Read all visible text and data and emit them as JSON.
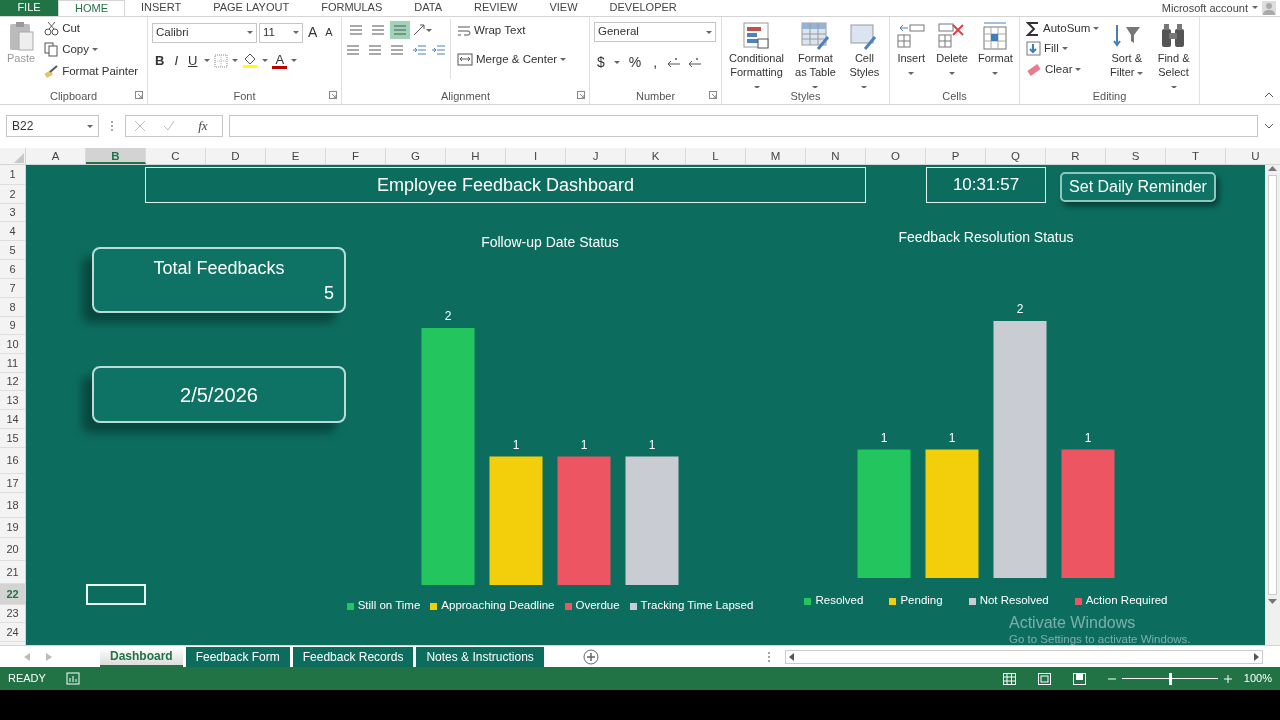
{
  "ribbon_tabs": [
    {
      "label": "FILE",
      "kind": "file",
      "selected": false
    },
    {
      "label": "HOME",
      "kind": "tab",
      "selected": true
    },
    {
      "label": "INSERT",
      "kind": "tab",
      "selected": false
    },
    {
      "label": "PAGE LAYOUT",
      "kind": "tab",
      "selected": false
    },
    {
      "label": "FORMULAS",
      "kind": "tab",
      "selected": false
    },
    {
      "label": "DATA",
      "kind": "tab",
      "selected": false
    },
    {
      "label": "REVIEW",
      "kind": "tab",
      "selected": false
    },
    {
      "label": "VIEW",
      "kind": "tab",
      "selected": false
    },
    {
      "label": "DEVELOPER",
      "kind": "tab",
      "selected": false
    }
  ],
  "account": "Microsoft account",
  "ribbon_groups": [
    {
      "kind": "clipboard",
      "label": "Clipboard",
      "buttons": [
        {
          "label": "Paste",
          "disabled": true
        },
        {
          "label": "Cut",
          "disabled": false
        },
        {
          "label": "Copy",
          "disabled": false
        },
        {
          "label": "Format Painter",
          "disabled": false
        }
      ]
    },
    {
      "kind": "font",
      "label": "Font",
      "font_name": "Calibri",
      "font_size": "11",
      "buttons": [
        "A",
        "A",
        "B",
        "I",
        "U",
        "A"
      ]
    },
    {
      "kind": "alignment",
      "label": "Alignment",
      "vertical_align": [
        {
          "selected": false
        },
        {
          "selected": false
        },
        {
          "selected": true
        }
      ],
      "buttons": [
        "Wrap Text",
        "Merge & Center"
      ]
    },
    {
      "kind": "number",
      "label": "Number",
      "format": "General",
      "buttons": [
        "$",
        "%",
        ","
      ]
    },
    {
      "kind": "large",
      "label": "Styles",
      "buttons": [
        "Conditional Formatting",
        "Format as Table",
        "Cell Styles"
      ]
    },
    {
      "kind": "large",
      "label": "Cells",
      "buttons": [
        "Insert",
        "Delete",
        "Format"
      ]
    },
    {
      "kind": "editing",
      "label": "Editing",
      "buttons": [
        "AutoSum",
        "Fill",
        "Clear",
        "Sort & Filter",
        "Find & Select"
      ]
    }
  ],
  "formula_bar": {
    "name_box": "B22",
    "function_label": "fx"
  },
  "columns": [
    {
      "label": "A",
      "selected": false
    },
    {
      "label": "B",
      "selected": true
    },
    {
      "label": "C",
      "selected": false
    },
    {
      "label": "D",
      "selected": false
    },
    {
      "label": "E",
      "selected": false
    },
    {
      "label": "F",
      "selected": false
    },
    {
      "label": "G",
      "selected": false
    },
    {
      "label": "H",
      "selected": false
    },
    {
      "label": "I",
      "selected": false
    },
    {
      "label": "J",
      "selected": false
    },
    {
      "label": "K",
      "selected": false
    },
    {
      "label": "L",
      "selected": false
    },
    {
      "label": "M",
      "selected": false
    },
    {
      "label": "N",
      "selected": false
    },
    {
      "label": "O",
      "selected": false
    },
    {
      "label": "P",
      "selected": false
    },
    {
      "label": "Q",
      "selected": false
    },
    {
      "label": "R",
      "selected": false
    },
    {
      "label": "S",
      "selected": false
    },
    {
      "label": "T",
      "selected": false
    },
    {
      "label": "U",
      "selected": false
    }
  ],
  "rows": [
    {
      "label": "1",
      "selected": false
    },
    {
      "label": "2",
      "selected": false
    },
    {
      "label": "3",
      "selected": false
    },
    {
      "label": "4",
      "selected": false
    },
    {
      "label": "5",
      "selected": false
    },
    {
      "label": "6",
      "selected": false
    },
    {
      "label": "7",
      "selected": false
    },
    {
      "label": "8",
      "selected": false
    },
    {
      "label": "9",
      "selected": false
    },
    {
      "label": "10",
      "selected": false
    },
    {
      "label": "11",
      "selected": false
    },
    {
      "label": "12",
      "selected": false
    },
    {
      "label": "13",
      "selected": false
    },
    {
      "label": "14",
      "selected": false
    },
    {
      "label": "15",
      "selected": false
    },
    {
      "label": "16",
      "selected": false
    },
    {
      "label": "17",
      "selected": false
    },
    {
      "label": "18",
      "selected": false
    },
    {
      "label": "19",
      "selected": false
    },
    {
      "label": "20",
      "selected": false
    },
    {
      "label": "21",
      "selected": false
    },
    {
      "label": "22",
      "selected": true
    },
    {
      "label": "23",
      "selected": false
    },
    {
      "label": "24",
      "selected": false
    }
  ],
  "dashboard": {
    "title": "Employee Feedback Dashboard",
    "clock": "10:31:57",
    "reminder_button": "Set Daily Reminder",
    "total_card": {
      "label": "Total Feedbacks",
      "value": "5"
    },
    "date_card": "2/5/2026",
    "charts": [
      {
        "chart_data": {
          "type": "bar",
          "title": "Follow-up Date Status",
          "series": [
            {
              "name": "Still on Time",
              "color": "#22c55e",
              "values": [
                2
              ]
            },
            {
              "name": "Approaching Deadline",
              "color": "#f2cf0a",
              "values": [
                1
              ]
            },
            {
              "name": "Overdue",
              "color": "#ee5563",
              "values": [
                1
              ]
            },
            {
              "name": "Tracking Time Lapsed",
              "color": "#c9cdd3",
              "values": [
                1
              ]
            }
          ],
          "data_labels": true
        }
      },
      {
        "chart_data": {
          "type": "bar",
          "title": "Feedback Resolution Status",
          "series": [
            {
              "name": "Resolved",
              "color": "#22c55e",
              "values": [
                1
              ]
            },
            {
              "name": "Pending",
              "color": "#f2cf0a",
              "values": [
                1
              ]
            },
            {
              "name": "Not Resolved",
              "color": "#c9cdd3",
              "values": [
                2
              ]
            },
            {
              "name": "Action Required",
              "color": "#ee5563",
              "values": [
                1
              ]
            }
          ],
          "data_labels": true
        }
      }
    ]
  },
  "os_notice": {
    "title": "Activate Windows",
    "text": "Go to Settings to activate Windows."
  },
  "sheet_tabs": [
    {
      "label": "Dashboard",
      "selected": true
    },
    {
      "label": "Feedback Form",
      "selected": false
    },
    {
      "label": "Feedback Records",
      "selected": false
    },
    {
      "label": "Notes & Instructions",
      "selected": false
    }
  ],
  "status_bar": {
    "status": "READY",
    "zoom": {
      "level": 0.5,
      "reading": "100%"
    }
  }
}
